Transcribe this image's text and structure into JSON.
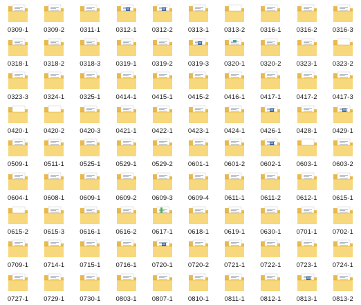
{
  "view": "explorer-large-icons",
  "colors": {
    "folder_back": "#e9b949",
    "folder_front": "#f7d87c",
    "folder_edge": "#d9a733",
    "page": "#ffffff",
    "page_line": "#9aa4b0",
    "accent_blue": "#2f5ea8",
    "accent_teal": "#3aa89a",
    "accent_green": "#4fae5a"
  },
  "folders": [
    {
      "name": "0309-1",
      "preview": "doc"
    },
    {
      "name": "0309-2",
      "preview": "doc"
    },
    {
      "name": "0311-1",
      "preview": "doc"
    },
    {
      "name": "0312-1",
      "preview": "blue"
    },
    {
      "name": "0312-2",
      "preview": "blue"
    },
    {
      "name": "0313-1",
      "preview": "doc"
    },
    {
      "name": "0313-2",
      "preview": "plain"
    },
    {
      "name": "0316-1",
      "preview": "doc"
    },
    {
      "name": "0316-2",
      "preview": "doc"
    },
    {
      "name": "0316-3",
      "preview": "doc"
    },
    {
      "name": "0318-1",
      "preview": "doc"
    },
    {
      "name": "0318-2",
      "preview": "doc"
    },
    {
      "name": "0318-3",
      "preview": "doc"
    },
    {
      "name": "0319-1",
      "preview": "doc"
    },
    {
      "name": "0319-2",
      "preview": "doc"
    },
    {
      "name": "0319-3",
      "preview": "blue"
    },
    {
      "name": "0320-1",
      "preview": "teal"
    },
    {
      "name": "0320-2",
      "preview": "doc"
    },
    {
      "name": "0323-1",
      "preview": "doc"
    },
    {
      "name": "0323-2",
      "preview": "plain"
    },
    {
      "name": "0323-3",
      "preview": "doc"
    },
    {
      "name": "0324-1",
      "preview": "doc"
    },
    {
      "name": "0325-1",
      "preview": "doc"
    },
    {
      "name": "0414-1",
      "preview": "doc"
    },
    {
      "name": "0415-1",
      "preview": "doc"
    },
    {
      "name": "0415-2",
      "preview": "doc"
    },
    {
      "name": "0416-1",
      "preview": "doc"
    },
    {
      "name": "0417-1",
      "preview": "doc"
    },
    {
      "name": "0417-2",
      "preview": "doc"
    },
    {
      "name": "0417-3",
      "preview": "doc"
    },
    {
      "name": "0420-1",
      "preview": "plain"
    },
    {
      "name": "0420-2",
      "preview": "plain"
    },
    {
      "name": "0420-3",
      "preview": "doc"
    },
    {
      "name": "0421-1",
      "preview": "doc"
    },
    {
      "name": "0422-1",
      "preview": "doc"
    },
    {
      "name": "0423-1",
      "preview": "doc"
    },
    {
      "name": "0424-1",
      "preview": "doc"
    },
    {
      "name": "0426-1",
      "preview": "blue"
    },
    {
      "name": "0428-1",
      "preview": "doc"
    },
    {
      "name": "0429-1",
      "preview": "blue"
    },
    {
      "name": "0509-1",
      "preview": "doc"
    },
    {
      "name": "0511-1",
      "preview": "doc"
    },
    {
      "name": "0525-1",
      "preview": "doc"
    },
    {
      "name": "0529-1",
      "preview": "doc"
    },
    {
      "name": "0529-2",
      "preview": "doc"
    },
    {
      "name": "0601-1",
      "preview": "doc"
    },
    {
      "name": "0601-2",
      "preview": "doc"
    },
    {
      "name": "0602-1",
      "preview": "blue"
    },
    {
      "name": "0603-1",
      "preview": "plain"
    },
    {
      "name": "0603-2",
      "preview": "doc"
    },
    {
      "name": "0604-1",
      "preview": "doc"
    },
    {
      "name": "0608-1",
      "preview": "doc"
    },
    {
      "name": "0609-1",
      "preview": "doc"
    },
    {
      "name": "0609-2",
      "preview": "doc"
    },
    {
      "name": "0609-3",
      "preview": "doc"
    },
    {
      "name": "0609-4",
      "preview": "doc"
    },
    {
      "name": "0611-1",
      "preview": "doc"
    },
    {
      "name": "0611-2",
      "preview": "doc"
    },
    {
      "name": "0612-1",
      "preview": "doc"
    },
    {
      "name": "0615-1",
      "preview": "doc"
    },
    {
      "name": "0615-2",
      "preview": "plain"
    },
    {
      "name": "0615-3",
      "preview": "doc"
    },
    {
      "name": "0616-1",
      "preview": "doc"
    },
    {
      "name": "0616-2",
      "preview": "doc"
    },
    {
      "name": "0617-1",
      "preview": "green"
    },
    {
      "name": "0618-1",
      "preview": "doc"
    },
    {
      "name": "0619-1",
      "preview": "doc"
    },
    {
      "name": "0630-1",
      "preview": "doc"
    },
    {
      "name": "0701-1",
      "preview": "doc"
    },
    {
      "name": "0702-1",
      "preview": "doc"
    },
    {
      "name": "0709-1",
      "preview": "doc"
    },
    {
      "name": "0714-1",
      "preview": "doc"
    },
    {
      "name": "0715-1",
      "preview": "doc"
    },
    {
      "name": "0716-1",
      "preview": "doc"
    },
    {
      "name": "0720-1",
      "preview": "blue"
    },
    {
      "name": "0720-2",
      "preview": "doc"
    },
    {
      "name": "0721-1",
      "preview": "doc"
    },
    {
      "name": "0722-1",
      "preview": "doc"
    },
    {
      "name": "0723-1",
      "preview": "doc"
    },
    {
      "name": "0724-1",
      "preview": "doc"
    },
    {
      "name": "0727-1",
      "preview": "doc"
    },
    {
      "name": "0729-1",
      "preview": "doc"
    },
    {
      "name": "0730-1",
      "preview": "doc"
    },
    {
      "name": "0803-1",
      "preview": "doc"
    },
    {
      "name": "0807-1",
      "preview": "doc"
    },
    {
      "name": "0810-1",
      "preview": "doc"
    },
    {
      "name": "0811-1",
      "preview": "doc"
    },
    {
      "name": "0812-1",
      "preview": "doc"
    },
    {
      "name": "0813-1",
      "preview": "blue"
    },
    {
      "name": "0813-2",
      "preview": "doc"
    }
  ]
}
